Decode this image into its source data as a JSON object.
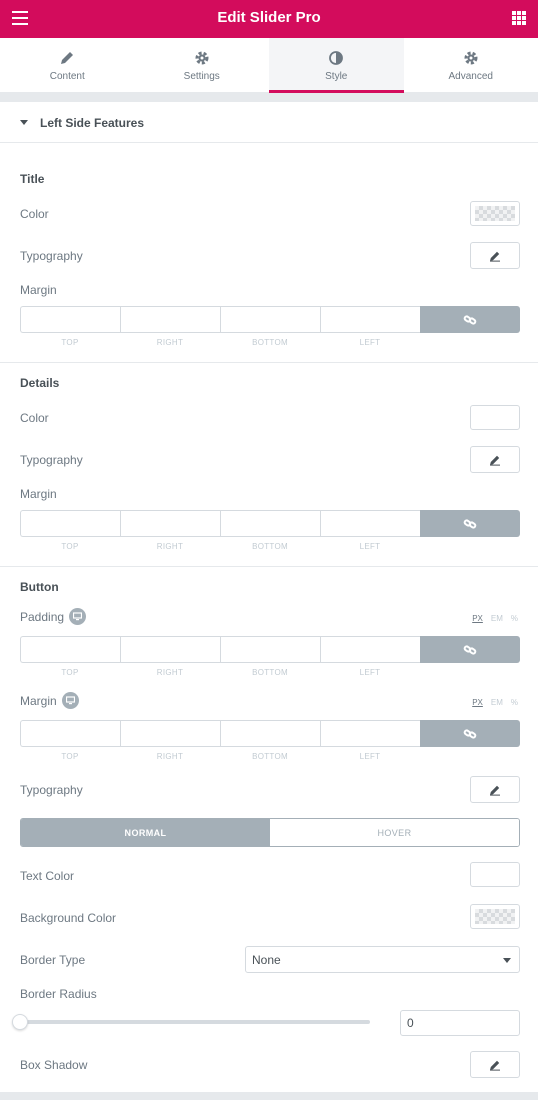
{
  "header": {
    "title": "Edit Slider Pro",
    "menu_icon": "hamburger-icon",
    "apps_icon": "grid-icon",
    "accent": "#d30c5c"
  },
  "tabs": [
    {
      "label": "Content",
      "icon": "pencil-icon",
      "active": false
    },
    {
      "label": "Settings",
      "icon": "gear-icon",
      "active": false
    },
    {
      "label": "Style",
      "icon": "contrast-icon",
      "active": true
    },
    {
      "label": "Advanced",
      "icon": "gear-icon",
      "active": false
    }
  ],
  "section": {
    "title": "Left Side Features",
    "expanded": true
  },
  "dim_labels": {
    "top": "Top",
    "right": "Right",
    "bottom": "Bottom",
    "left": "Left"
  },
  "title_group": {
    "heading": "Title",
    "color_label": "Color",
    "typography_label": "Typography",
    "margin_label": "Margin"
  },
  "details_group": {
    "heading": "Details",
    "color_label": "Color",
    "typography_label": "Typography",
    "margin_label": "Margin"
  },
  "button_group": {
    "heading": "Button",
    "padding_label": "Padding",
    "margin_label": "Margin",
    "units": [
      "PX",
      "EM",
      "%"
    ],
    "active_unit": "PX",
    "typography_label": "Typography",
    "state_tabs": {
      "normal": "NORMAL",
      "hover": "HOVER",
      "active": "normal"
    },
    "text_color_label": "Text Color",
    "background_color_label": "Background Color",
    "border_type_label": "Border Type",
    "border_type_value": "None",
    "border_radius_label": "Border Radius",
    "border_radius_value": "0",
    "box_shadow_label": "Box Shadow"
  }
}
